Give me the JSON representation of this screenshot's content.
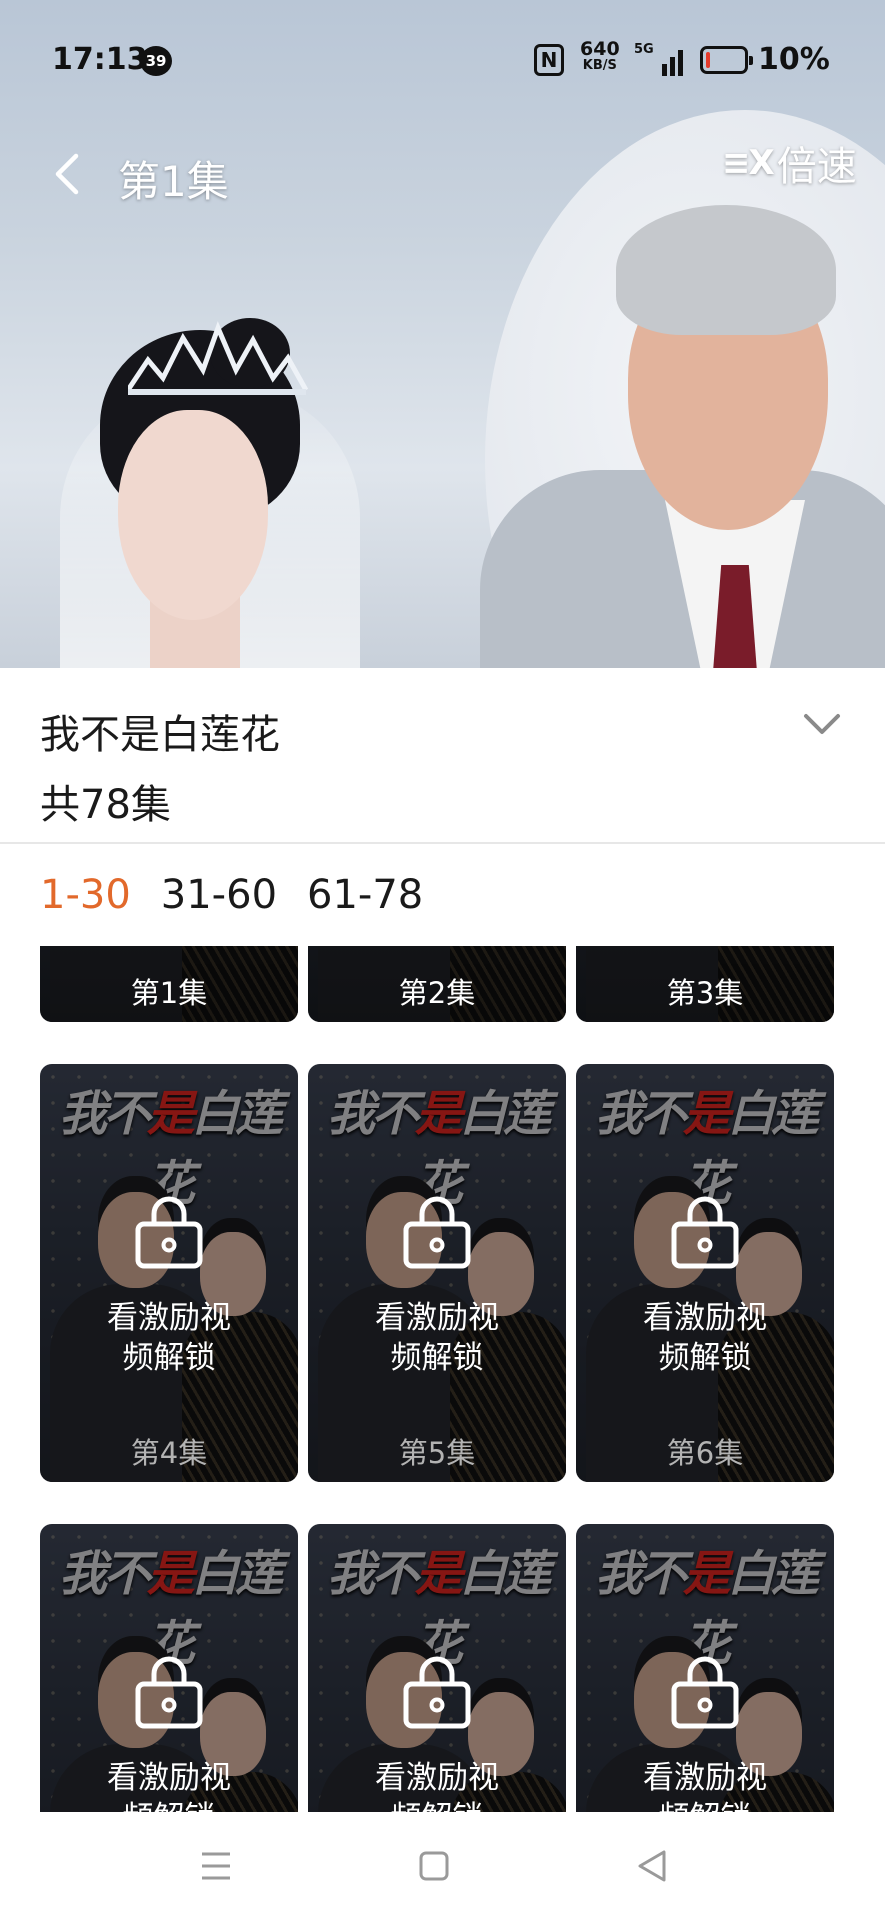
{
  "status_bar": {
    "time": "17:13",
    "notification_count": "39",
    "nfc": "N",
    "net_speed": "640",
    "net_speed_unit": "KB/S",
    "network": "5G",
    "battery_percent": "10%",
    "battery_level": 0.1
  },
  "player": {
    "episode_title": "第1集",
    "speed_label": "倍速"
  },
  "drama": {
    "title": "我不是白莲花",
    "episode_total": "共78集"
  },
  "range_tabs": [
    {
      "label": "1-30",
      "active": true
    },
    {
      "label": "31-60",
      "active": false
    },
    {
      "label": "61-78",
      "active": false
    }
  ],
  "episodes": [
    {
      "label": "第1集",
      "locked": false
    },
    {
      "label": "第2集",
      "locked": false
    },
    {
      "label": "第3集",
      "locked": false
    },
    {
      "label": "第4集",
      "locked": true,
      "lock_text_1": "看激励视",
      "lock_text_2": "频解锁"
    },
    {
      "label": "第5集",
      "locked": true,
      "lock_text_1": "看激励视",
      "lock_text_2": "频解锁"
    },
    {
      "label": "第6集",
      "locked": true,
      "lock_text_1": "看激励视",
      "lock_text_2": "频解锁"
    },
    {
      "label": "",
      "locked": true,
      "lock_text_1": "看激励视",
      "lock_text_2": "频解锁"
    },
    {
      "label": "",
      "locked": true,
      "lock_text_1": "看激励视",
      "lock_text_2": "频解锁"
    },
    {
      "label": "",
      "locked": true,
      "lock_text_1": "看激励视",
      "lock_text_2": "频解锁"
    }
  ],
  "poster": {
    "title_a": "我不",
    "title_red": "是",
    "title_b": "白莲花"
  },
  "colors": {
    "accent": "#e2692b",
    "poster_red": "#d8251f"
  },
  "nav_icons": [
    "menu-icon",
    "home-square-icon",
    "back-triangle-icon"
  ]
}
